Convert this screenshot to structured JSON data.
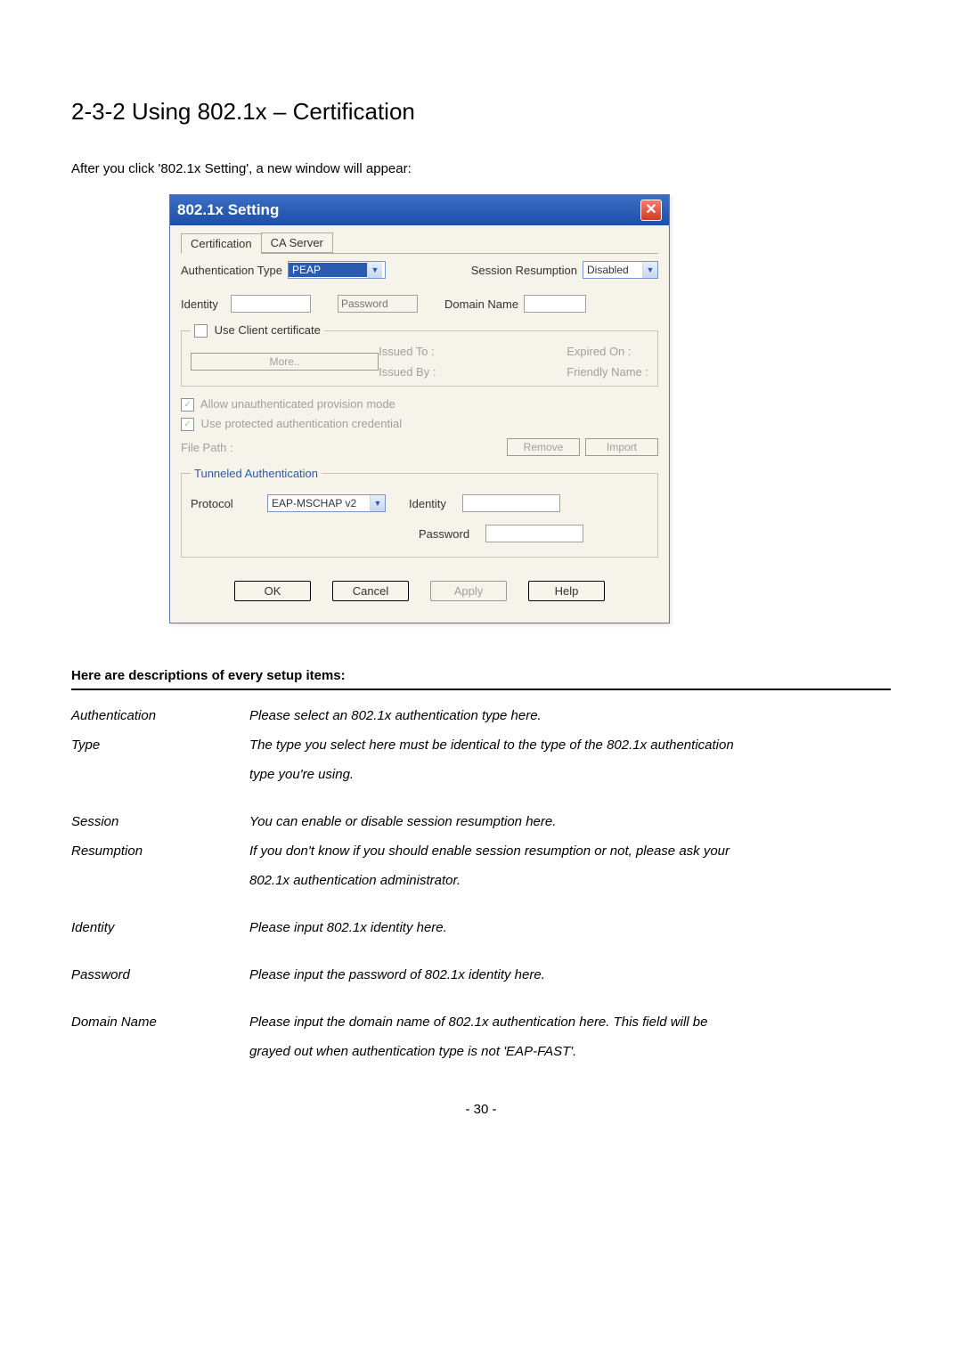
{
  "heading": "2-3-2 Using 802.1x – Certification",
  "intro": "After you click '802.1x Setting', a new window will appear:",
  "dialog": {
    "title": "802.1x Setting",
    "tabs": [
      "Certification",
      "CA Server"
    ],
    "auth_type_label": "Authentication Type",
    "auth_type_value": "PEAP",
    "session_resumption_label": "Session Resumption",
    "session_resumption_value": "Disabled",
    "identity_label": "Identity",
    "password_placeholder": "Password",
    "domain_name_label": "Domain Name",
    "client_cert": {
      "legend": "Use Client certificate",
      "issued_to": "Issued To :",
      "expired_on": "Expired On :",
      "issued_by": "Issued By :",
      "friendly_name": "Friendly Name :",
      "more_btn": "More.."
    },
    "provision": {
      "allow_unauth": "Allow unauthenticated provision mode",
      "use_protected": "Use protected authentication credential",
      "file_path": "File Path :",
      "remove_btn": "Remove",
      "import_btn": "Import"
    },
    "tunneled": {
      "legend": "Tunneled Authentication",
      "protocol_label": "Protocol",
      "protocol_value": "EAP-MSCHAP v2",
      "identity_label": "Identity",
      "password_label": "Password"
    },
    "buttons": {
      "ok": "OK",
      "cancel": "Cancel",
      "apply": "Apply",
      "help": "Help"
    }
  },
  "desc_heading": "Here are descriptions of every setup items:",
  "descriptions": [
    {
      "term_lines": [
        "Authentication",
        "Type"
      ],
      "body_lines": [
        "Please select an 802.1x authentication type here.",
        "The type you select here must be identical to the type of the 802.1x authentication",
        "type you're using."
      ]
    },
    {
      "term_lines": [
        "Session",
        "Resumption"
      ],
      "body_lines": [
        "You can enable or disable session resumption here.",
        "If you don't know if you should enable session resumption or not, please ask your",
        "802.1x authentication administrator."
      ]
    },
    {
      "term_lines": [
        "Identity"
      ],
      "body_lines": [
        "Please input 802.1x identity here."
      ]
    },
    {
      "term_lines": [
        "Password"
      ],
      "body_lines": [
        "Please input the password of 802.1x identity here."
      ]
    },
    {
      "term_lines": [
        "Domain Name"
      ],
      "body_lines": [
        "Please input the domain name of 802.1x authentication here. This field will be",
        "grayed out when authentication type is not 'EAP-FAST'."
      ]
    }
  ],
  "page_number": "- 30 -"
}
